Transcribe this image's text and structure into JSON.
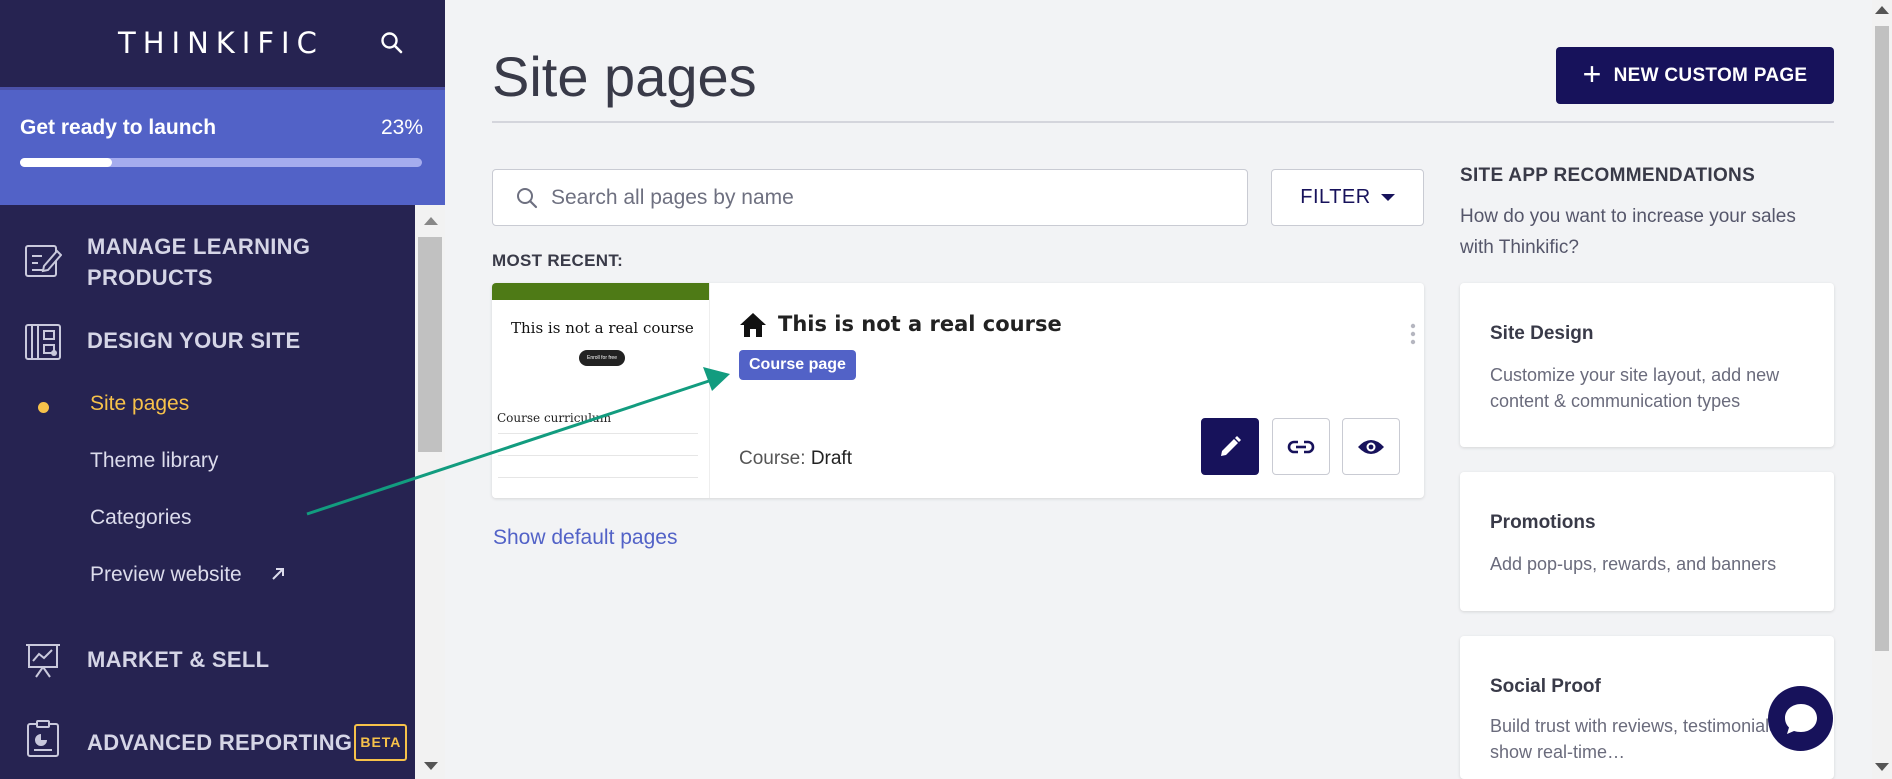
{
  "sidebar": {
    "logo": "THINKIFIC",
    "launch": {
      "title": "Get ready to launch",
      "percent_label": "23%",
      "progress": 0.23
    },
    "nav": {
      "manage_line1": "MANAGE LEARNING",
      "manage_line2": "PRODUCTS",
      "design": "DESIGN YOUR SITE",
      "sub_items": [
        "Site pages",
        "Theme library",
        "Categories",
        "Preview website"
      ],
      "market": "MARKET & SELL",
      "reporting": "ADVANCED REPORTING",
      "beta": "BETA"
    }
  },
  "main": {
    "title": "Site pages",
    "new_button": "NEW CUSTOM PAGE",
    "search": {
      "placeholder": "Search all pages by name"
    },
    "filter": "FILTER",
    "most_recent": "MOST RECENT:",
    "card": {
      "title": "This is not a real course",
      "badge": "Course page",
      "status_label": "Course:",
      "status_value": "Draft",
      "thumb": {
        "title": "This is not a real course",
        "button": "Enroll for free",
        "curriculum": "Course curriculum"
      }
    },
    "show_default": "Show default pages"
  },
  "recommendations": {
    "title": "SITE APP RECOMMENDATIONS",
    "subtitle": "How do you want to increase your sales with Thinkific?",
    "cards": [
      {
        "title": "Site Design",
        "desc": "Customize your site layout, add new content & communication types"
      },
      {
        "title": "Promotions",
        "desc": "Add pop-ups, rewards, and banners"
      },
      {
        "title": "Social Proof",
        "desc": "Build trust with reviews, testimonials, show real-time…"
      }
    ]
  },
  "colors": {
    "sidebar_bg": "#262351",
    "launch_bg": "#5262c7",
    "accent_yellow": "#f7c24a",
    "primary_button": "#17125b",
    "annotation_arrow": "#129c7f"
  }
}
